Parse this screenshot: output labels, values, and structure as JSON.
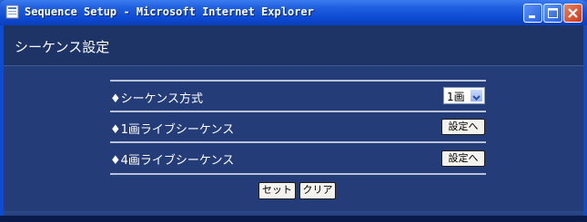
{
  "window": {
    "title": "Sequence Setup - Microsoft Internet Explorer",
    "controls": {
      "minimize": "minimize",
      "maximize": "maximize",
      "close": "close"
    }
  },
  "page": {
    "title": "シーケンス設定"
  },
  "settings": {
    "rows": [
      {
        "label": "♦シーケンス方式",
        "select_value": "1画"
      },
      {
        "label": "♦1画ライブシーケンス",
        "button_label": "設定へ"
      },
      {
        "label": "♦4画ライブシーケンス",
        "button_label": "設定へ"
      }
    ],
    "set_button": "セット",
    "clear_button": "クリア"
  },
  "colors": {
    "titlebar": "#0e4bd4",
    "content_bg": "#243d79",
    "header_bg": "#1e3466",
    "close_button": "#c8391a"
  }
}
